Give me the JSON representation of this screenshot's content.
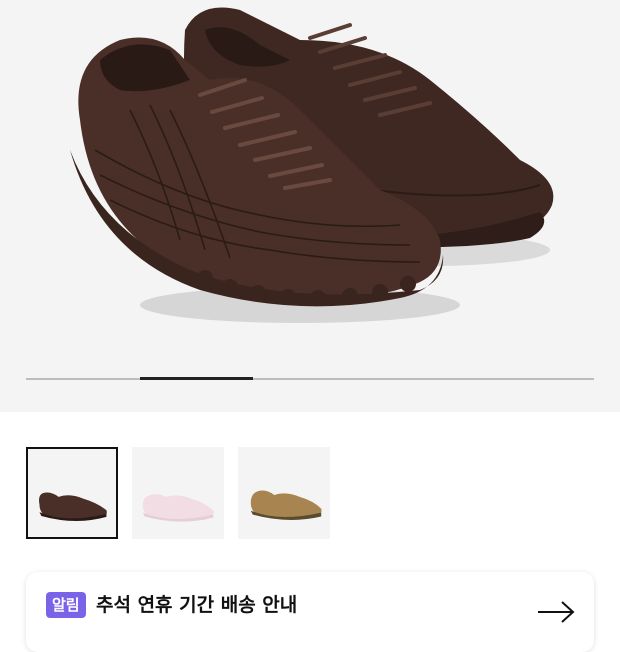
{
  "gallery": {
    "current_slide": 2,
    "total_slides": 5,
    "thumbnails": [
      {
        "label": "Brown",
        "color": "#4a2f28",
        "selected": true
      },
      {
        "label": "White",
        "color": "#f1dde3",
        "selected": false
      },
      {
        "label": "Tan",
        "color": "#a88550",
        "selected": false
      }
    ]
  },
  "notice": {
    "badge": "알림",
    "title": "추석 연휴 기간 배송 안내",
    "badge_color": "#7b63e8"
  },
  "colors": {
    "shoe_main": "#4a2f28",
    "background": "#f4f4f4"
  }
}
